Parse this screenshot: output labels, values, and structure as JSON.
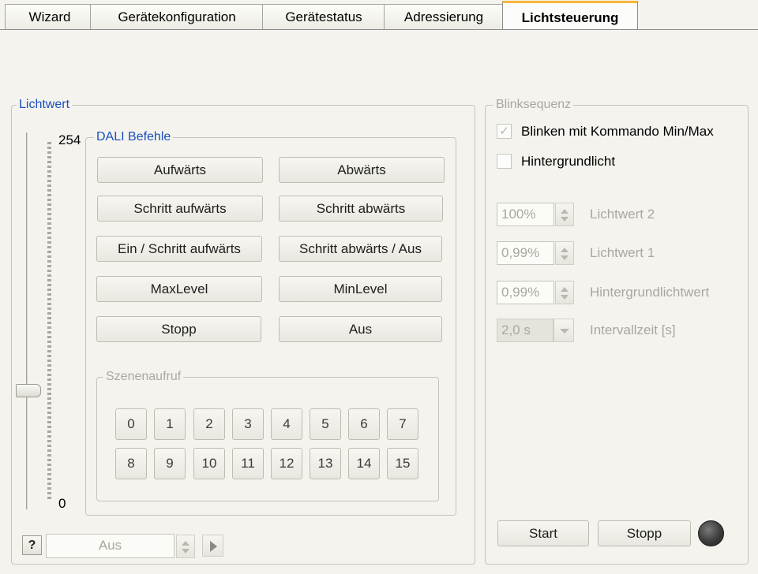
{
  "tabs": [
    "Wizard",
    "Gerätekonfiguration",
    "Gerätestatus",
    "Adressierung",
    "Lichtsteuerung"
  ],
  "lichtwert": {
    "legend": "Lichtwert",
    "max_label": "254",
    "min_label": "0",
    "slider_fraction": 0.31
  },
  "dali": {
    "legend": "DALI Befehle",
    "buttons": [
      "Aufwärts",
      "Abwärts",
      "Schritt aufwärts",
      "Schritt abwärts",
      "Ein / Schritt aufwärts",
      "Schritt abwärts / Aus",
      "MaxLevel",
      "MinLevel",
      "Stopp",
      "Aus"
    ]
  },
  "szenen": {
    "legend": "Szenenaufruf",
    "buttons": [
      "0",
      "1",
      "2",
      "3",
      "4",
      "5",
      "6",
      "7",
      "8",
      "9",
      "10",
      "11",
      "12",
      "13",
      "14",
      "15"
    ]
  },
  "bottom": {
    "help": "?",
    "value": "Aus"
  },
  "blink": {
    "legend": "Blinksequenz",
    "check1_label": "Blinken mit Kommando Min/Max",
    "check1_checked": true,
    "check1_mark": "✓",
    "check2_label": "Hintergrundlicht",
    "check2_checked": false,
    "fields": [
      {
        "value": "100%",
        "label": "Lichtwert 2"
      },
      {
        "value": "0,99%",
        "label": "Lichtwert 1"
      },
      {
        "value": "0,99%",
        "label": "Hintergrundlichtwert"
      }
    ],
    "interval": {
      "value": "2,0 s",
      "label": "Intervallzeit [s]"
    },
    "start_label": "Start",
    "stop_label": "Stopp",
    "led_color": "#3c3c3c"
  }
}
